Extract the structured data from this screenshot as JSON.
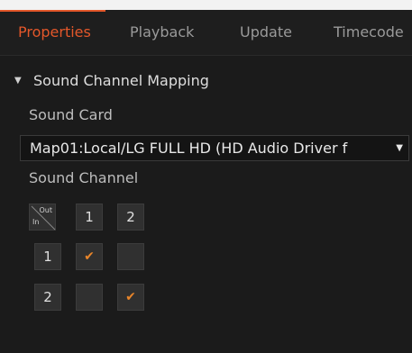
{
  "tabs": [
    {
      "label": "Properties",
      "active": true
    },
    {
      "label": "Playback",
      "active": false
    },
    {
      "label": "Update",
      "active": false
    },
    {
      "label": "Timecode",
      "active": false
    }
  ],
  "section": {
    "title": "Sound Channel Mapping",
    "expanded": true
  },
  "sound_card": {
    "label": "Sound Card",
    "value": "Map01:Local/LG FULL HD (HD Audio Driver f"
  },
  "sound_channel": {
    "label": "Sound Channel",
    "corner_out": "Out",
    "corner_in": "In",
    "out_headers": [
      "1",
      "2"
    ],
    "in_headers": [
      "1",
      "2"
    ],
    "mapping": [
      [
        true,
        false
      ],
      [
        false,
        true
      ]
    ]
  },
  "colors": {
    "accent": "#e3572a",
    "check": "#e8852a",
    "background": "#1b1b1b"
  }
}
